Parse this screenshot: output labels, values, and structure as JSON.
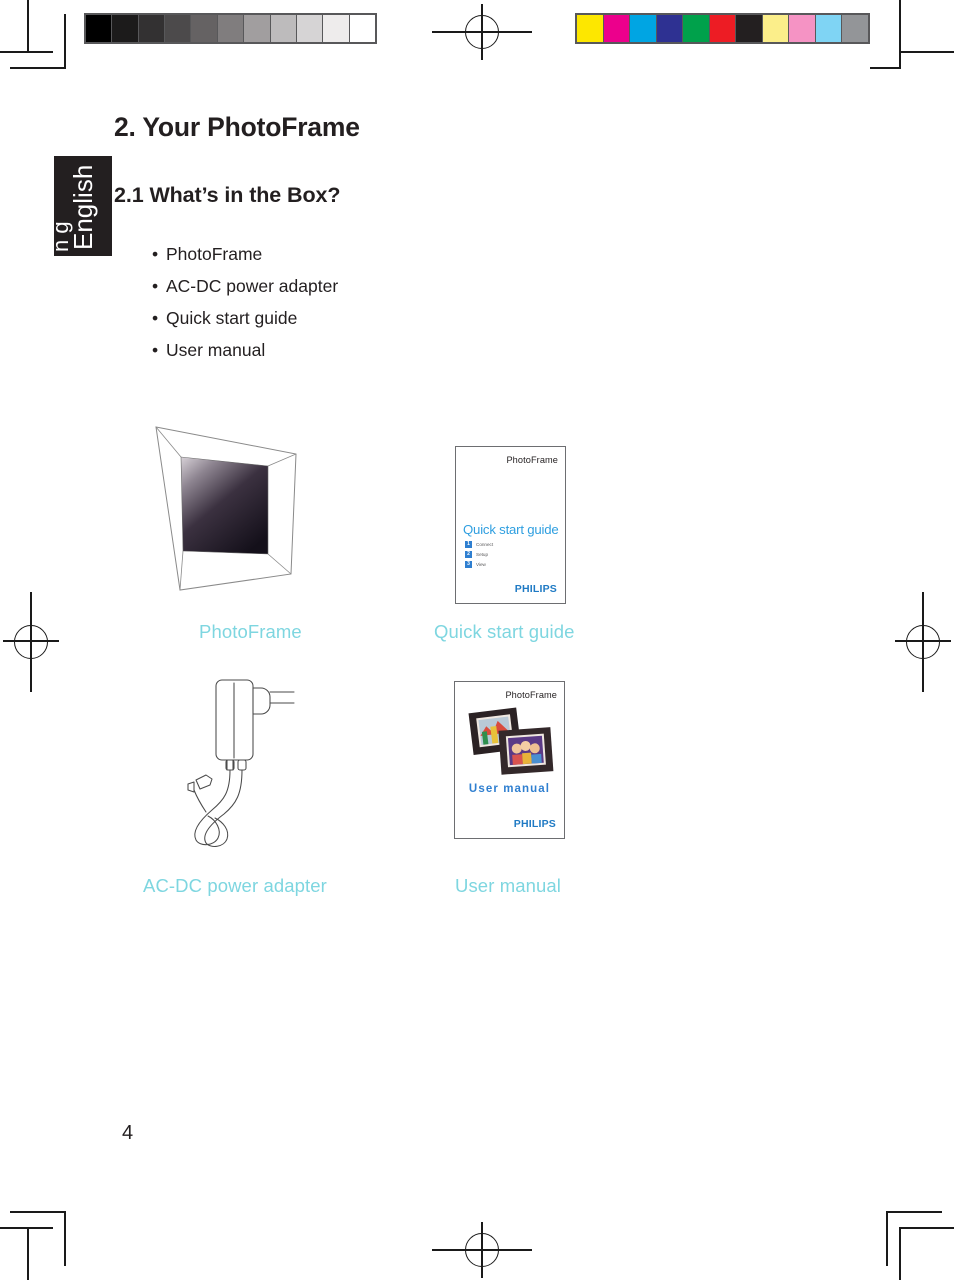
{
  "document": {
    "page_number": "4",
    "language_tab": "English",
    "chapter_title": "2. Your PhotoFrame",
    "section_title": "2.1 What’s in the Box?",
    "box_contents": [
      "PhotoFrame",
      "AC-DC power adapter",
      "Quick start guide",
      "User manual"
    ],
    "bullet_glyph": "•"
  },
  "figures": [
    {
      "id": "photoframe",
      "caption": "PhotoFrame",
      "icon": "photoframe-illustration"
    },
    {
      "id": "quick-start-guide",
      "caption": "Quick start guide",
      "icon": "booklet-cover"
    },
    {
      "id": "ac-dc-power-adapter",
      "caption": "AC-DC power adapter",
      "icon": "power-adapter-illustration"
    },
    {
      "id": "user-manual",
      "caption": "User manual",
      "icon": "booklet-cover"
    }
  ],
  "quick_start_booklet": {
    "brand_word": "PhotoFrame",
    "title": "Quick start guide",
    "steps": [
      {
        "number": "1",
        "label": "Connect"
      },
      {
        "number": "2",
        "label": "Setup"
      },
      {
        "number": "3",
        "label": "View"
      }
    ],
    "logo": "PHILIPS"
  },
  "user_manual_booklet": {
    "brand_word": "PhotoFrame",
    "title": "User manual",
    "logo": "PHILIPS"
  },
  "print_marks": {
    "grayscale_bar": [
      "#000000",
      "#1c1b1b",
      "#333132",
      "#4c4a4b",
      "#656263",
      "#807d7e",
      "#a19e9f",
      "#bdbbbc",
      "#d6d4d5",
      "#eeecec",
      "#ffffff"
    ],
    "color_bar": [
      "#fde700",
      "#ec008c",
      "#00a5e3",
      "#2e3192",
      "#00a14b",
      "#ed1c24",
      "#231f20",
      "#fbee8a",
      "#f593c4",
      "#7fd4f4",
      "#939598"
    ],
    "registration_mark": "registration-target"
  },
  "colors": {
    "caption": "#7ed6e0",
    "text": "#231f20",
    "philips_blue": "#1f7ac4",
    "heading_blue": "#2f9fe0"
  }
}
